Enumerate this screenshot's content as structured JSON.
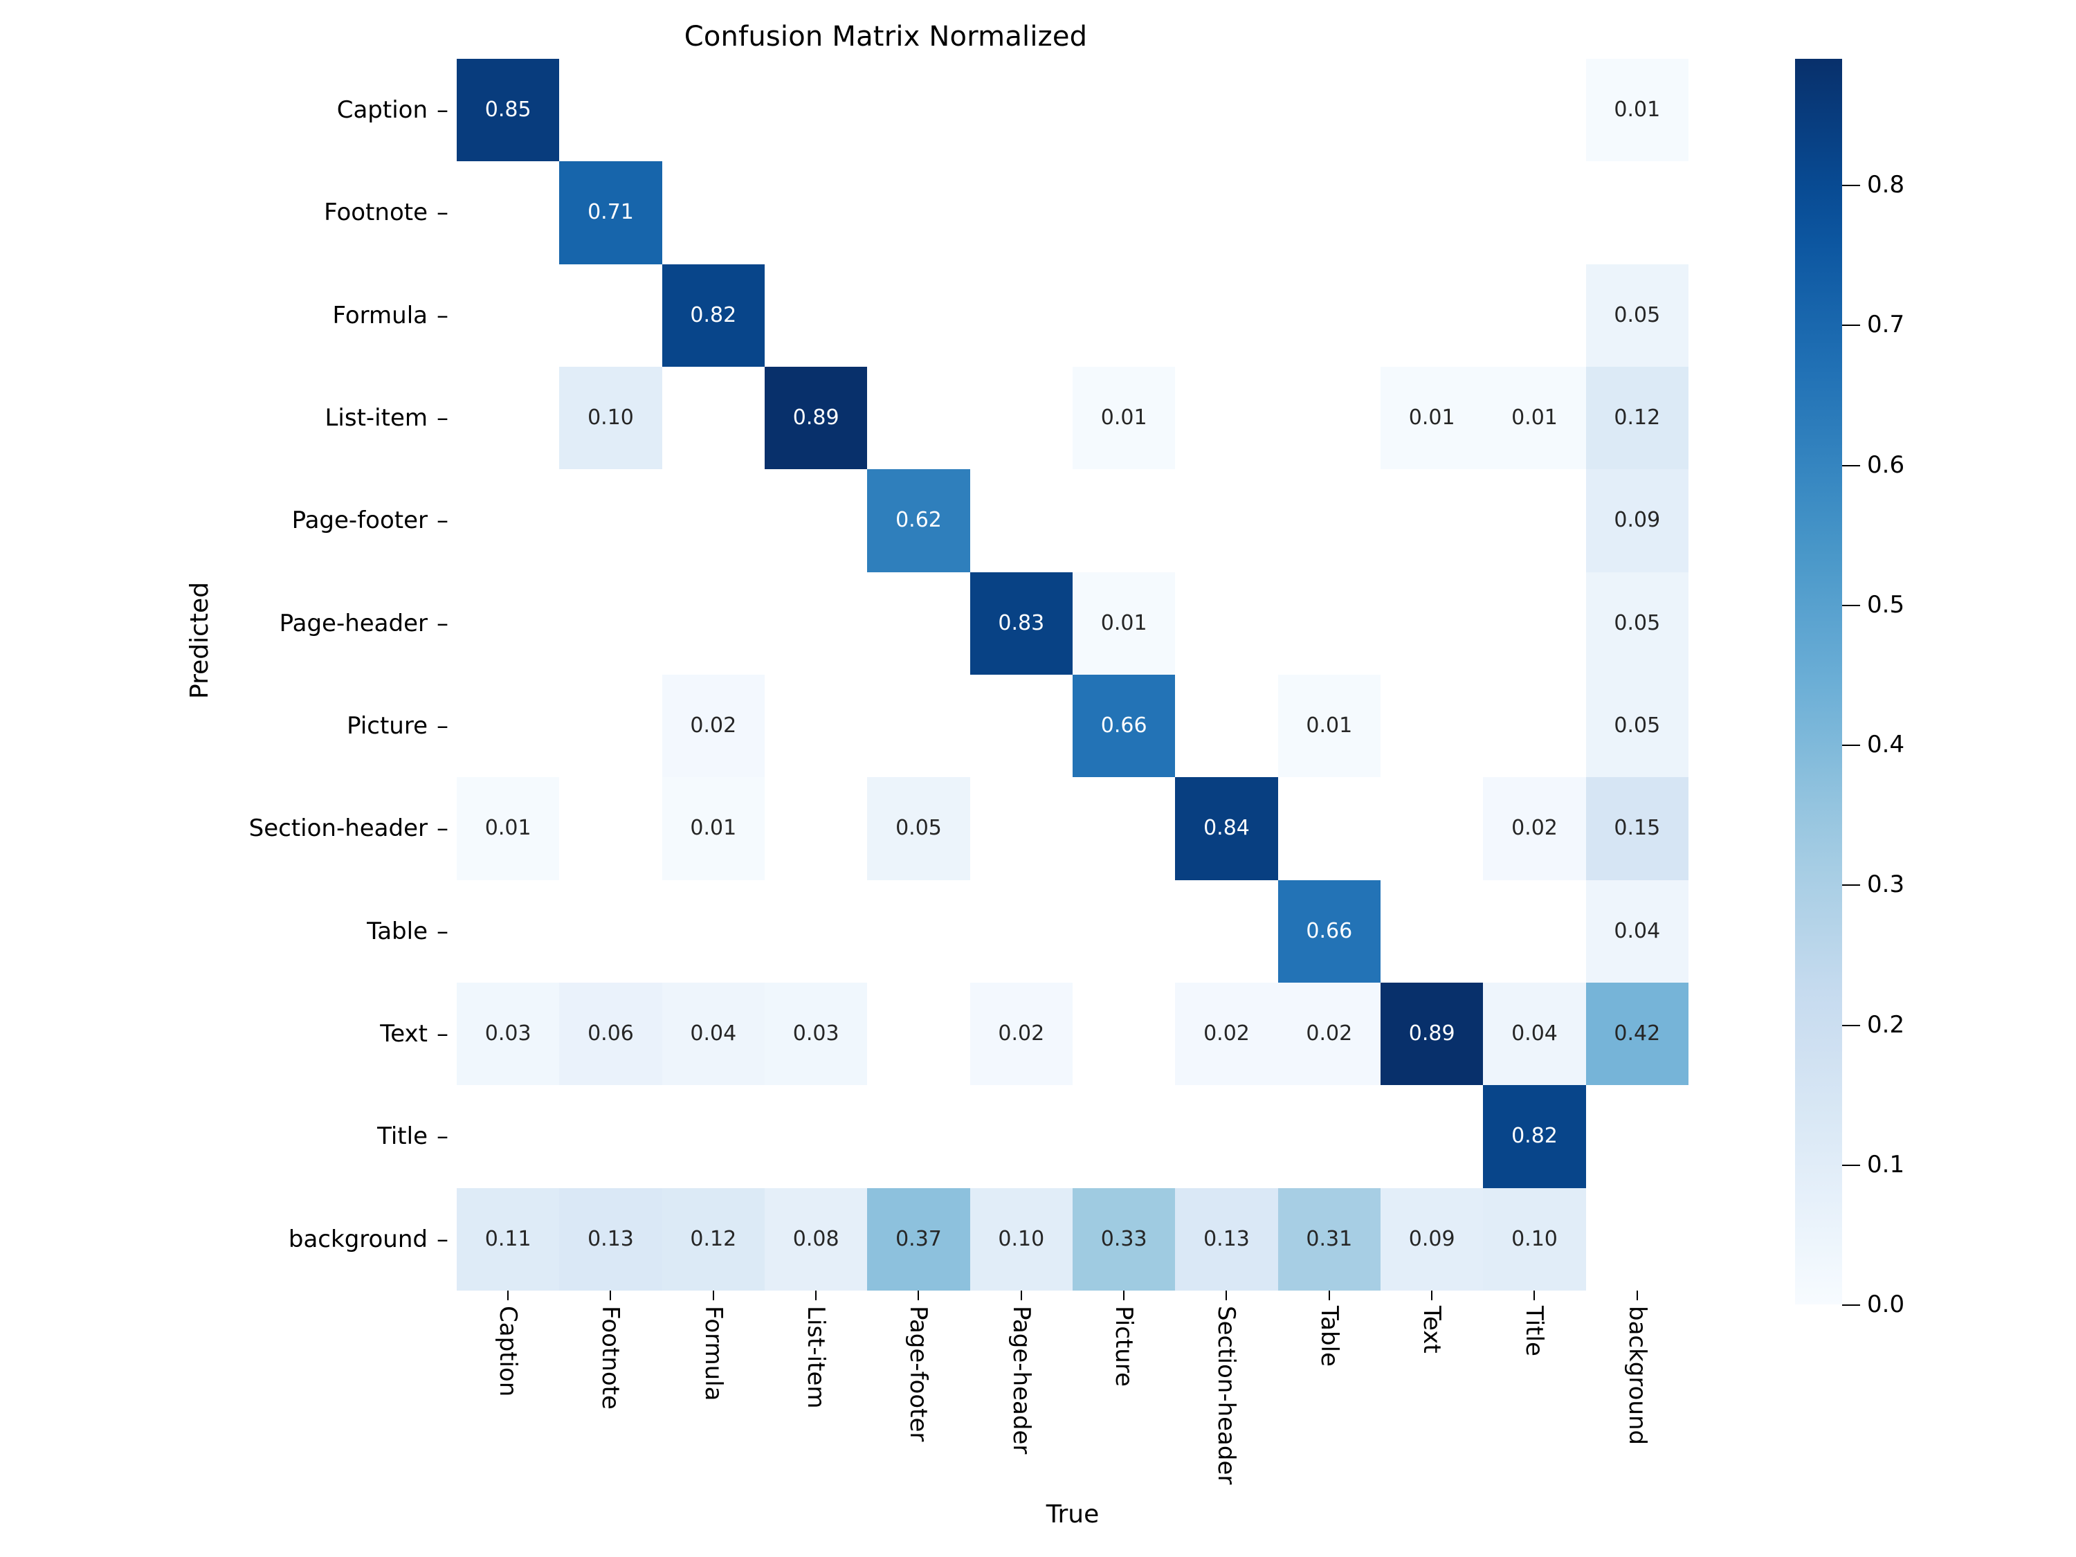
{
  "chart_data": {
    "type": "heatmap",
    "title": "Confusion Matrix Normalized",
    "xlabel": "True",
    "ylabel": "Predicted",
    "colormap": "Blues",
    "grid": false,
    "legend_position": "right",
    "colorbar": {
      "min": 0.0,
      "max": 0.89,
      "ticks": [
        "0.0",
        "0.1",
        "0.2",
        "0.3",
        "0.4",
        "0.5",
        "0.6",
        "0.7",
        "0.8"
      ],
      "tick_values": [
        0.0,
        0.1,
        0.2,
        0.3,
        0.4,
        0.5,
        0.6,
        0.7,
        0.8
      ]
    },
    "x_categories": [
      "Caption",
      "Footnote",
      "Formula",
      "List-item",
      "Page-footer",
      "Page-header",
      "Picture",
      "Section-header",
      "Table",
      "Text",
      "Title",
      "background"
    ],
    "y_categories": [
      "Caption",
      "Footnote",
      "Formula",
      "List-item",
      "Page-footer",
      "Page-header",
      "Picture",
      "Section-header",
      "Table",
      "Text",
      "Title",
      "background"
    ],
    "values": [
      [
        0.85,
        null,
        null,
        null,
        null,
        null,
        null,
        null,
        null,
        null,
        null,
        0.01
      ],
      [
        null,
        0.71,
        null,
        null,
        null,
        null,
        null,
        null,
        null,
        null,
        null,
        null
      ],
      [
        null,
        null,
        0.82,
        null,
        null,
        null,
        null,
        null,
        null,
        null,
        null,
        0.05
      ],
      [
        null,
        0.1,
        null,
        0.89,
        null,
        null,
        0.01,
        null,
        null,
        0.01,
        0.01,
        0.12
      ],
      [
        null,
        null,
        null,
        null,
        0.62,
        null,
        null,
        null,
        null,
        null,
        null,
        0.09
      ],
      [
        null,
        null,
        null,
        null,
        null,
        0.83,
        0.01,
        null,
        null,
        null,
        null,
        0.05
      ],
      [
        null,
        null,
        0.02,
        null,
        null,
        null,
        0.66,
        null,
        0.01,
        null,
        null,
        0.05
      ],
      [
        0.01,
        null,
        0.01,
        null,
        0.05,
        null,
        null,
        0.84,
        null,
        null,
        0.02,
        0.15
      ],
      [
        null,
        null,
        null,
        null,
        null,
        null,
        null,
        null,
        0.66,
        null,
        null,
        0.04
      ],
      [
        0.03,
        0.06,
        0.04,
        0.03,
        null,
        0.02,
        null,
        0.02,
        0.02,
        0.89,
        0.04,
        0.42
      ],
      [
        null,
        null,
        null,
        null,
        null,
        null,
        null,
        null,
        null,
        null,
        0.82,
        null
      ],
      [
        0.11,
        0.13,
        0.12,
        0.08,
        0.37,
        0.1,
        0.33,
        0.13,
        0.31,
        0.09,
        0.1,
        null
      ]
    ],
    "cell_labels": [
      [
        "0.85",
        "",
        "",
        "",
        "",
        "",
        "",
        "",
        "",
        "",
        "",
        "0.01"
      ],
      [
        "",
        "0.71",
        "",
        "",
        "",
        "",
        "",
        "",
        "",
        "",
        "",
        ""
      ],
      [
        "",
        "",
        "0.82",
        "",
        "",
        "",
        "",
        "",
        "",
        "",
        "",
        "0.05"
      ],
      [
        "",
        "0.10",
        "",
        "0.89",
        "",
        "",
        "0.01",
        "",
        "",
        "0.01",
        "0.01",
        "0.12"
      ],
      [
        "",
        "",
        "",
        "",
        "0.62",
        "",
        "",
        "",
        "",
        "",
        "",
        "0.09"
      ],
      [
        "",
        "",
        "",
        "",
        "",
        "0.83",
        "0.01",
        "",
        "",
        "",
        "",
        "0.05"
      ],
      [
        "",
        "",
        "0.02",
        "",
        "",
        "",
        "0.66",
        "",
        "0.01",
        "",
        "",
        "0.05"
      ],
      [
        "0.01",
        "",
        "0.01",
        "",
        "0.05",
        "",
        "",
        "0.84",
        "",
        "",
        "0.02",
        "0.15"
      ],
      [
        "",
        "",
        "",
        "",
        "",
        "",
        "",
        "",
        "0.66",
        "",
        "",
        "0.04"
      ],
      [
        "0.03",
        "0.06",
        "0.04",
        "0.03",
        "",
        "0.02",
        "",
        "0.02",
        "0.02",
        "0.89",
        "0.04",
        "0.42"
      ],
      [
        "",
        "",
        "",
        "",
        "",
        "",
        "",
        "",
        "",
        "",
        "0.82",
        ""
      ],
      [
        "0.11",
        "0.13",
        "0.12",
        "0.08",
        "0.37",
        "0.10",
        "0.33",
        "0.13",
        "0.31",
        "0.09",
        "0.10",
        ""
      ]
    ]
  },
  "colors": {
    "cmap_low": "#f7fbff",
    "cmap_high": "#08306b",
    "text_dark": "#262626",
    "text_light": "#ffffff",
    "background": "#ffffff"
  },
  "tick_dash": "–"
}
